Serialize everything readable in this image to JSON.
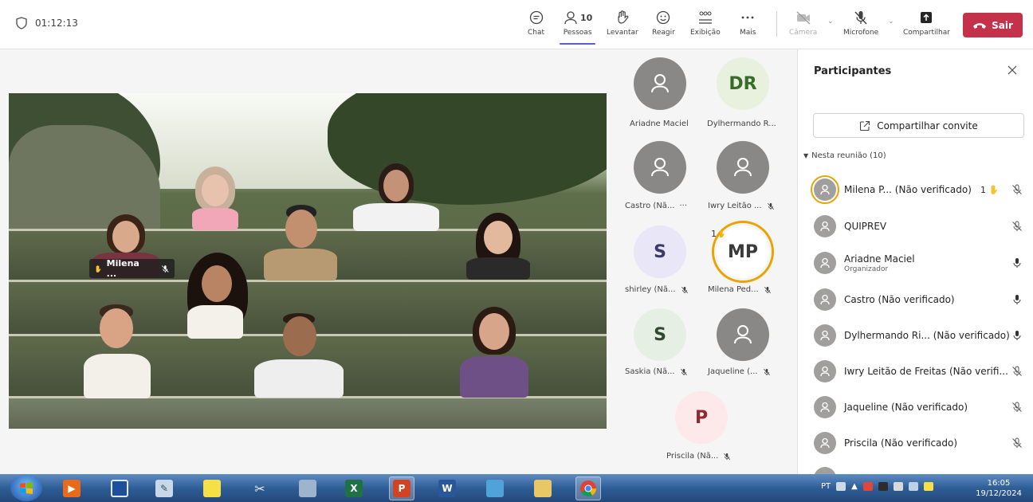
{
  "topbar": {
    "timer": "01:12:13",
    "chat": "Chat",
    "people_count": "10",
    "people": "Pessoas",
    "raise": "Levantar",
    "react": "Reagir",
    "view": "Exibição",
    "more": "Mais",
    "camera": "Câmera",
    "mic": "Microfone",
    "share": "Compartilhar",
    "leave": "Sair",
    "leave_color": "#c4314b"
  },
  "stage": {
    "name_chip": "Milena ..."
  },
  "tiles": [
    {
      "initials": "",
      "name": "Ariadne Maciel"
    },
    {
      "initials": "DR",
      "name": "Dylhermando R..."
    },
    {
      "initials": "",
      "name": "Castro (Nã...",
      "extra": "···"
    },
    {
      "initials": "",
      "name": "Iwry Leitão ..."
    },
    {
      "initials": "S",
      "name": "shirley (Nã..."
    },
    {
      "initials": "MP",
      "name": "Milena Ped...",
      "hand": "1"
    },
    {
      "initials": "S",
      "name": "Saskia (Nã..."
    },
    {
      "initials": "",
      "name": "Jaqueline (..."
    },
    {
      "initials": "P",
      "name": "Priscila (Nã..."
    }
  ],
  "panel": {
    "title": "Participantes",
    "invite": "Compartilhar convite",
    "section": "Nesta reunião (10)",
    "hand_count": "1",
    "participants": [
      {
        "name": "Milena P... (Não verificado)"
      },
      {
        "name": "QUIPREV"
      },
      {
        "name": "Ariadne Maciel",
        "role": "Organizador"
      },
      {
        "name": "Castro (Não verificado)"
      },
      {
        "name": "Dylhermando Ri... (Não verificado)"
      },
      {
        "name": "Iwry Leitão de Freitas (Não verifi..."
      },
      {
        "name": "Jaqueline (Não verificado)"
      },
      {
        "name": "Priscila (Não verificado)"
      }
    ]
  },
  "taskbar": {
    "lang": "PT",
    "time": "16:05",
    "date": "19/12/2024"
  }
}
